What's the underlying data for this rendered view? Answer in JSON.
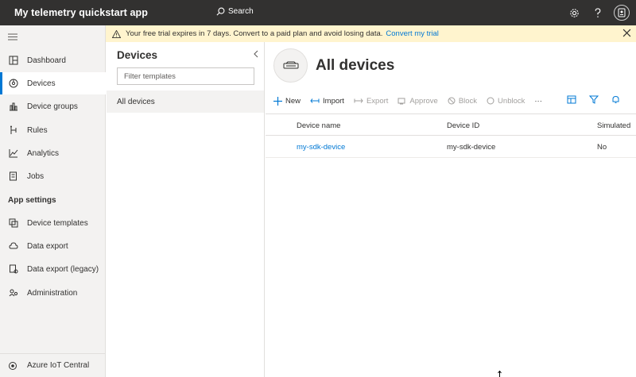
{
  "app": {
    "title": "My telemetry quickstart app"
  },
  "topbar": {
    "search_label": "Search",
    "icons": [
      "settings-icon",
      "help-icon",
      "account-icon"
    ]
  },
  "sidebar": {
    "items": [
      {
        "label": "Dashboard",
        "icon": "dashboard-icon"
      },
      {
        "label": "Devices",
        "icon": "devices-icon",
        "active": true
      },
      {
        "label": "Device groups",
        "icon": "device-groups-icon"
      },
      {
        "label": "Rules",
        "icon": "rules-icon"
      },
      {
        "label": "Analytics",
        "icon": "analytics-icon"
      },
      {
        "label": "Jobs",
        "icon": "jobs-icon"
      }
    ],
    "section_label": "App settings",
    "settings_items": [
      {
        "label": "Device templates",
        "icon": "device-templates-icon"
      },
      {
        "label": "Data export",
        "icon": "data-export-icon"
      },
      {
        "label": "Data export (legacy)",
        "icon": "data-export-legacy-icon"
      },
      {
        "label": "Administration",
        "icon": "administration-icon"
      }
    ],
    "footer_label": "Azure IoT Central"
  },
  "banner": {
    "message": "Your free trial expires in 7 days. Convert to a paid plan and avoid losing data.",
    "link_label": "Convert my trial"
  },
  "templates_panel": {
    "title": "Devices",
    "filter_placeholder": "Filter templates",
    "items": [
      {
        "label": "All devices",
        "selected": true
      }
    ]
  },
  "main": {
    "title": "All devices",
    "toolbar": {
      "new_label": "New",
      "import_label": "Import",
      "export_label": "Export",
      "approve_label": "Approve",
      "block_label": "Block",
      "unblock_label": "Unblock",
      "more_label": "···"
    },
    "table": {
      "columns": [
        "Device name",
        "Device ID",
        "Simulated"
      ],
      "rows": [
        {
          "device_name": "my-sdk-device",
          "device_id": "my-sdk-device",
          "simulated": "No"
        }
      ]
    }
  },
  "colors": {
    "accent": "#0078d4",
    "topbar": "#323130",
    "banner": "#fff4ce"
  }
}
